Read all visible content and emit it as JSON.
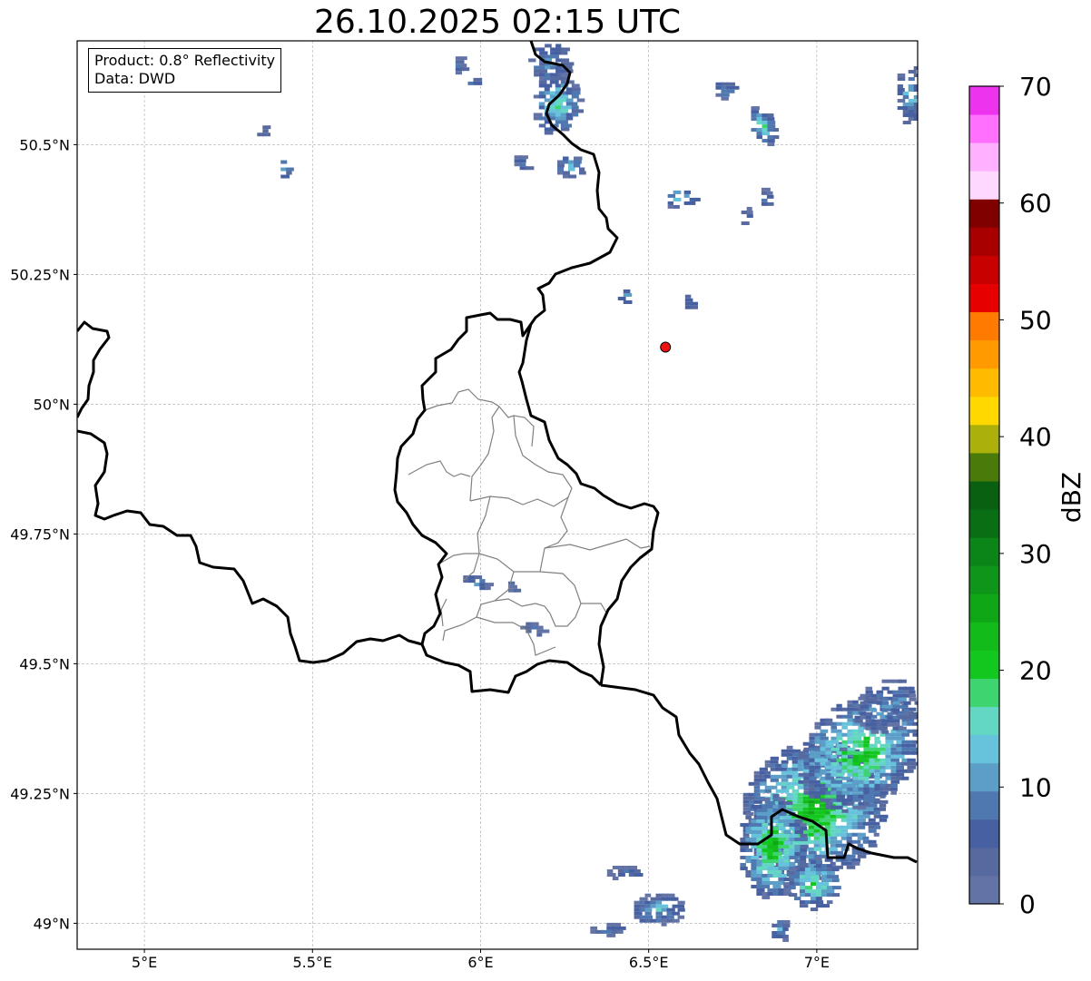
{
  "title": "26.10.2025 02:15 UTC",
  "info": {
    "product": "Product: 0.8° Reflectivity",
    "data": "Data: DWD"
  },
  "axes": {
    "lon_range": [
      4.8,
      7.3
    ],
    "lat_range": [
      48.95,
      50.7
    ],
    "lon_ticks": [
      5.0,
      5.5,
      6.0,
      6.5,
      7.0
    ],
    "lon_tick_labels": [
      "5°E",
      "5.5°E",
      "6°E",
      "6.5°E",
      "7°E"
    ],
    "lat_ticks": [
      49.0,
      49.25,
      49.5,
      49.75,
      50.0,
      50.25,
      50.5
    ],
    "lat_tick_labels": [
      "49°N",
      "49.25°N",
      "49.5°N",
      "49.75°N",
      "50°N",
      "50.25°N",
      "50.5°N"
    ],
    "grid": true
  },
  "marker": {
    "lon": 6.55,
    "lat": 50.11,
    "color": "#ee1111"
  },
  "colorbar": {
    "label": "dBZ",
    "min": 0,
    "max": 70,
    "tick_values": [
      0,
      10,
      20,
      30,
      40,
      50,
      60,
      70
    ],
    "tick_labels": [
      "0",
      "10",
      "20",
      "30",
      "40",
      "50",
      "60",
      "70"
    ],
    "colors": [
      "#6373a6",
      "#576aa0",
      "#4660a2",
      "#4f78b0",
      "#5c9ec8",
      "#67c2dc",
      "#63d6c4",
      "#3ed570",
      "#12c81e",
      "#12ba1a",
      "#10a716",
      "#0e951a",
      "#0b8418",
      "#0a6e14",
      "#096010",
      "#4a7a0a",
      "#abb00a",
      "#ffd800",
      "#ffbb00",
      "#ff9a00",
      "#ff7a00",
      "#e60000",
      "#c80000",
      "#a80000",
      "#800000",
      "#ffd8ff",
      "#ffb0ff",
      "#ff70ff",
      "#ee33ee"
    ]
  },
  "echoes": [
    {
      "lon": 6.98,
      "lat": 49.22,
      "rlon": 0.22,
      "rlat": 0.13,
      "rot": -35,
      "peak": 24,
      "dens": 0.9
    },
    {
      "lon": 7.12,
      "lat": 49.33,
      "rlon": 0.2,
      "rlat": 0.1,
      "rot": -35,
      "peak": 22,
      "dens": 0.85
    },
    {
      "lon": 6.86,
      "lat": 49.15,
      "rlon": 0.1,
      "rlat": 0.1,
      "rot": 0,
      "peak": 24,
      "dens": 0.9
    },
    {
      "lon": 7.2,
      "lat": 49.42,
      "rlon": 0.1,
      "rlat": 0.05,
      "rot": -30,
      "peak": 12,
      "dens": 0.7
    },
    {
      "lon": 6.98,
      "lat": 49.08,
      "rlon": 0.08,
      "rlat": 0.05,
      "rot": 0,
      "peak": 20,
      "dens": 0.8
    },
    {
      "lon": 6.22,
      "lat": 50.58,
      "rlon": 0.07,
      "rlat": 0.06,
      "rot": 0,
      "peak": 18,
      "dens": 0.85
    },
    {
      "lon": 6.2,
      "lat": 50.66,
      "rlon": 0.06,
      "rlat": 0.04,
      "rot": 0,
      "peak": 12,
      "dens": 0.8
    },
    {
      "lon": 6.26,
      "lat": 50.46,
      "rlon": 0.04,
      "rlat": 0.02,
      "rot": 0,
      "peak": 16,
      "dens": 0.75
    },
    {
      "lon": 6.72,
      "lat": 50.61,
      "rlon": 0.03,
      "rlat": 0.02,
      "rot": 0,
      "peak": 12,
      "dens": 0.8
    },
    {
      "lon": 6.83,
      "lat": 50.54,
      "rlon": 0.04,
      "rlat": 0.04,
      "rot": -20,
      "peak": 17,
      "dens": 0.8
    },
    {
      "lon": 6.58,
      "lat": 50.4,
      "rlon": 0.06,
      "rlat": 0.02,
      "rot": 0,
      "peak": 18,
      "dens": 0.75
    },
    {
      "lon": 6.84,
      "lat": 50.4,
      "rlon": 0.02,
      "rlat": 0.02,
      "rot": 0,
      "peak": 8,
      "dens": 0.7
    },
    {
      "lon": 6.78,
      "lat": 50.37,
      "rlon": 0.02,
      "rlat": 0.02,
      "rot": 0,
      "peak": 8,
      "dens": 0.7
    },
    {
      "lon": 6.42,
      "lat": 50.21,
      "rlon": 0.02,
      "rlat": 0.015,
      "rot": 0,
      "peak": 18,
      "dens": 0.7
    },
    {
      "lon": 6.62,
      "lat": 50.2,
      "rlon": 0.02,
      "rlat": 0.015,
      "rot": 0,
      "peak": 10,
      "dens": 0.75
    },
    {
      "lon": 5.41,
      "lat": 50.46,
      "rlon": 0.015,
      "rlat": 0.02,
      "rot": 0,
      "peak": 18,
      "dens": 0.8
    },
    {
      "lon": 5.34,
      "lat": 50.52,
      "rlon": 0.01,
      "rlat": 0.02,
      "rot": 30,
      "peak": 12,
      "dens": 0.8
    },
    {
      "lon": 5.98,
      "lat": 49.66,
      "rlon": 0.04,
      "rlat": 0.012,
      "rot": 25,
      "peak": 12,
      "dens": 0.75
    },
    {
      "lon": 6.15,
      "lat": 49.57,
      "rlon": 0.04,
      "rlat": 0.01,
      "rot": 20,
      "peak": 8,
      "dens": 0.75
    },
    {
      "lon": 6.09,
      "lat": 49.65,
      "rlon": 0.02,
      "rlat": 0.008,
      "rot": 20,
      "peak": 6,
      "dens": 0.7
    },
    {
      "lon": 6.52,
      "lat": 49.03,
      "rlon": 0.08,
      "rlat": 0.03,
      "rot": 0,
      "peak": 14,
      "dens": 0.8
    },
    {
      "lon": 6.42,
      "lat": 49.1,
      "rlon": 0.05,
      "rlat": 0.015,
      "rot": 0,
      "peak": 7,
      "dens": 0.75
    },
    {
      "lon": 6.37,
      "lat": 48.99,
      "rlon": 0.05,
      "rlat": 0.012,
      "rot": 0,
      "peak": 8,
      "dens": 0.75
    },
    {
      "lon": 6.88,
      "lat": 48.99,
      "rlon": 0.03,
      "rlat": 0.025,
      "rot": 0,
      "peak": 12,
      "dens": 0.8
    },
    {
      "lon": 7.27,
      "lat": 50.6,
      "rlon": 0.04,
      "rlat": 0.06,
      "rot": 0,
      "peak": 14,
      "dens": 0.8
    },
    {
      "lon": 5.97,
      "lat": 50.62,
      "rlon": 0.02,
      "rlat": 0.01,
      "rot": 0,
      "peak": 10,
      "dens": 0.7
    },
    {
      "lon": 5.93,
      "lat": 50.66,
      "rlon": 0.02,
      "rlat": 0.02,
      "rot": 0,
      "peak": 8,
      "dens": 0.7
    },
    {
      "lon": 6.12,
      "lat": 50.47,
      "rlon": 0.03,
      "rlat": 0.015,
      "rot": 0,
      "peak": 8,
      "dens": 0.7
    }
  ]
}
